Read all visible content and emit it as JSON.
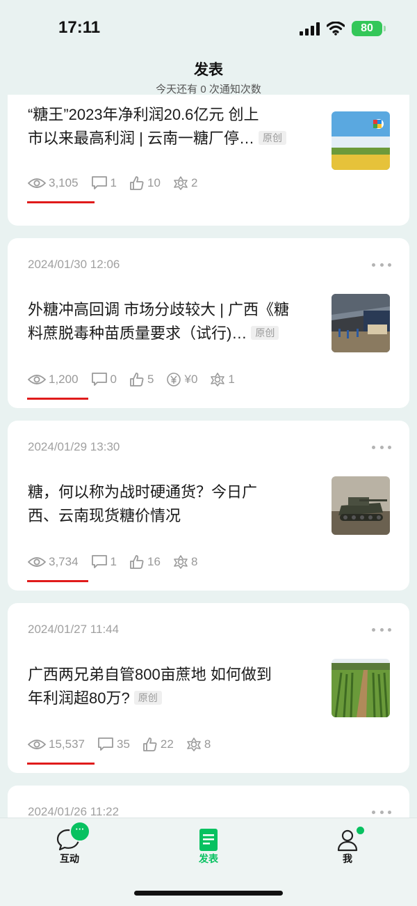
{
  "status": {
    "time": "17:11",
    "battery": "80"
  },
  "header": {
    "title": "发表",
    "subtitle": "今天还有 0 次通知次数"
  },
  "posts": [
    {
      "title_line1": "“糖王”2023年净利润20.6亿元 创上",
      "title_line2": "市以来最高利润 | 云南一糖厂停…",
      "tag": "原创",
      "views": "3,105",
      "comments": "1",
      "likes": "10",
      "shares": "2"
    },
    {
      "date": "2024/01/30 12:06",
      "title_line1": "外糖冲高回调 市场分歧较大 | 广西《糖",
      "title_line2": "料蔗脱毒种苗质量要求（试行)…",
      "tag": "原创",
      "views": "1,200",
      "comments": "0",
      "likes": "5",
      "reward": "¥0",
      "shares": "1"
    },
    {
      "date": "2024/01/29 13:30",
      "title_line1": "糖，何以称为战时硬通货？今日广",
      "title_line2": "西、云南现货糖价情况",
      "views": "3,734",
      "comments": "1",
      "likes": "16",
      "shares": "8"
    },
    {
      "date": "2024/01/27 11:44",
      "title_line1": "广西两兄弟自管800亩蔗地 如何做到",
      "title_line2": "年利润超80万?",
      "tag": "原创",
      "views": "15,537",
      "comments": "35",
      "likes": "22",
      "shares": "8"
    },
    {
      "date": "2024/01/26 11:22"
    }
  ],
  "tabs": [
    {
      "label": "互动",
      "badge": "···"
    },
    {
      "label": "发表"
    },
    {
      "label": "我"
    }
  ],
  "colors": {
    "accent": "#07c160",
    "underline": "#e01b1b",
    "background": "#e9f2f1"
  }
}
